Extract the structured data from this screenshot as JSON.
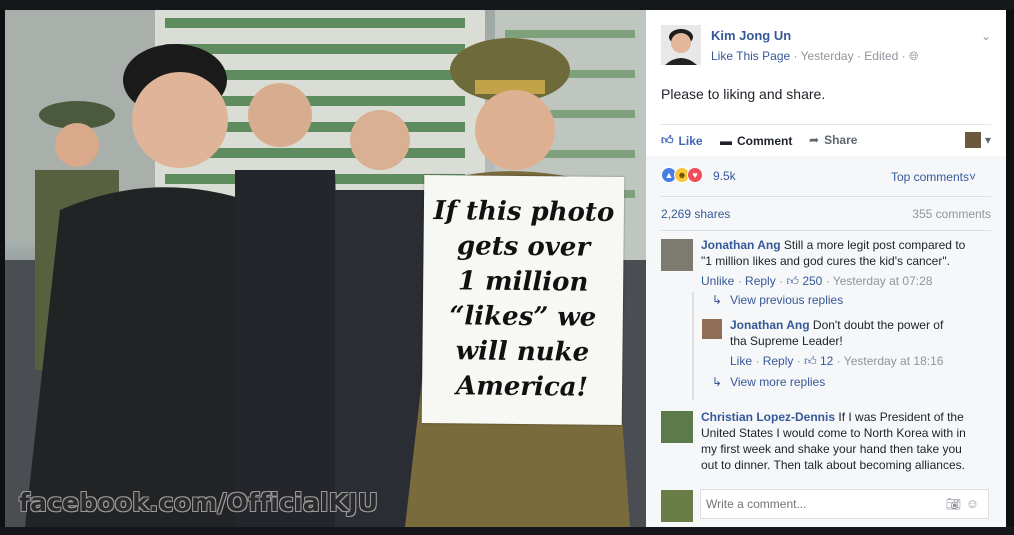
{
  "photo": {
    "sign_lines": [
      "If this photo",
      "gets over",
      "1 million",
      "“likes” we",
      "will nuke",
      "America!"
    ],
    "watermark": "facebook.com/OfficialKJU"
  },
  "post": {
    "page_name": "Kim Jong Un",
    "like_page": "Like This Page",
    "time": "Yesterday",
    "edited": "Edited",
    "text": "Please to liking and share."
  },
  "actions": {
    "like": "Like",
    "comment": "Comment",
    "share": "Share"
  },
  "stats": {
    "reactions_count": "9.5k",
    "top_comments": "Top comments",
    "shares": "2,269 shares",
    "comments": "355 comments"
  },
  "comments": [
    {
      "author": "Jonathan Ang",
      "text": "Still a more legit post compared to \"1 million likes and god cures the kid's cancer\".",
      "unlike": "Unlike",
      "reply": "Reply",
      "likes": "250",
      "time": "Yesterday at 07:28"
    },
    {
      "author": "Christian Lopez-Dennis",
      "text": "If I was President of the United States I would come to North Korea with in my first week and shake your hand then take you out to dinner. Then talk about becoming alliances."
    }
  ],
  "replies": {
    "view_previous": "View previous replies",
    "reply": {
      "author": "Jonathan Ang",
      "text": "Don't doubt the power of tha Supreme Leader!",
      "like": "Like",
      "reply_label": "Reply",
      "likes": "12",
      "time": "Yesterday at 18:16"
    },
    "view_more": "View more replies"
  },
  "composer": {
    "placeholder": "Write a comment..."
  },
  "colors": {
    "link": "#365899",
    "meta": "#90949c",
    "like_active": "#4267b2"
  }
}
